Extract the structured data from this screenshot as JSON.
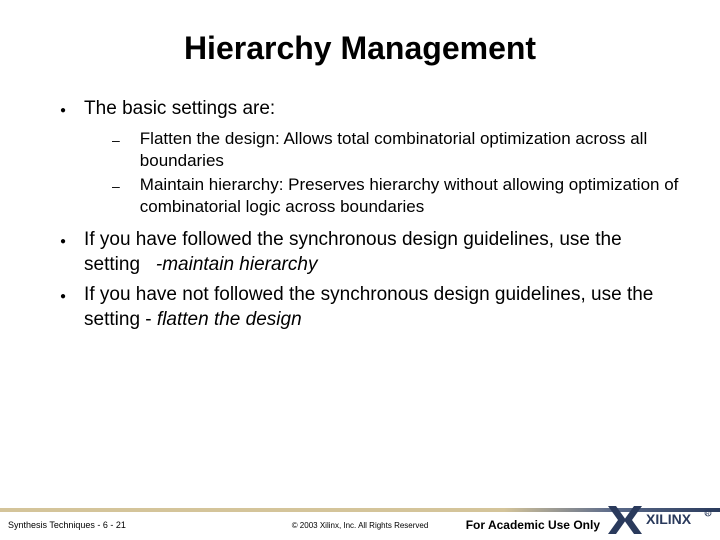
{
  "title": "Hierarchy Management",
  "bullets": [
    {
      "text": "The basic settings are:",
      "subs": [
        "Flatten the design: Allows total combinatorial optimization across all boundaries",
        "Maintain hierarchy: Preserves hierarchy without allowing optimization of combinatorial logic across boundaries"
      ]
    }
  ],
  "b2_pre": "If you have followed the synchronous design guidelines, use the setting   ",
  "b2_it": "-maintain hierarchy",
  "b3_pre": "If you have not followed the synchronous design guidelines, use the setting - ",
  "b3_it": "flatten the design",
  "footer": {
    "left": "Synthesis Techniques  -  6  - 21",
    "center": "© 2003 Xilinx, Inc. All Rights Reserved",
    "right": "For Academic Use Only"
  }
}
